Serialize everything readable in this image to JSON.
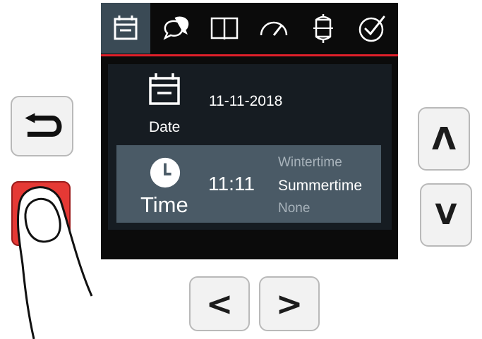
{
  "tabs": [
    {
      "icon": "calendar-icon"
    },
    {
      "icon": "chat-icon"
    },
    {
      "icon": "book-icon"
    },
    {
      "icon": "gauge-icon"
    },
    {
      "icon": "tank-icon"
    },
    {
      "icon": "check-circle-icon"
    }
  ],
  "date_row": {
    "label": "Date",
    "value": "11-11-2018",
    "icon": "calendar-icon"
  },
  "time_row": {
    "label": "Time",
    "value": "11:11",
    "icon": "clock-icon",
    "options": [
      "Wintertime",
      "Summertime",
      "None"
    ],
    "selected_option": "Summertime"
  },
  "buttons": {
    "back": {
      "icon": "return-arrow-icon"
    },
    "up": {
      "label": "Ʌ"
    },
    "down": {
      "label": "V"
    },
    "left": {
      "label": "<"
    },
    "right": {
      "label": ">"
    }
  },
  "colors": {
    "screen_bg": "#0b0b0b",
    "active_tab": "#3a4a55",
    "accent_red": "#e0202a",
    "selected_row": "#4a5a66",
    "pressed_button": "#e53935"
  }
}
